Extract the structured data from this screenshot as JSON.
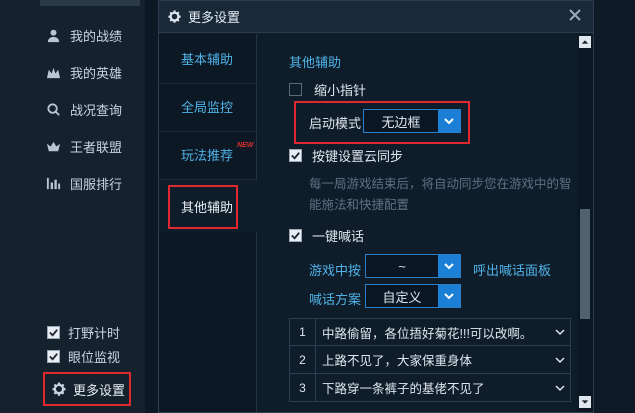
{
  "sidebar": {
    "top_item": "",
    "items": [
      {
        "label": "我的战绩",
        "icon": "user-icon"
      },
      {
        "label": "我的英雄",
        "icon": "hero-icon"
      },
      {
        "label": "战况查询",
        "icon": "search-icon"
      },
      {
        "label": "王者联盟",
        "icon": "crown-icon"
      },
      {
        "label": "国服排行",
        "icon": "bar-chart-icon"
      }
    ],
    "checks": [
      {
        "label": "打野计时",
        "checked": true
      },
      {
        "label": "眼位监视",
        "checked": true
      }
    ],
    "more_settings": "更多设置"
  },
  "dialog": {
    "title": "更多设置",
    "nav": [
      {
        "label": "基本辅助"
      },
      {
        "label": "全局监控"
      },
      {
        "label": "玩法推荐",
        "badge": "NEW"
      },
      {
        "label": "其他辅助",
        "active": true
      }
    ],
    "content": {
      "section_title": "其他辅助",
      "shrink_pointer": "缩小指针",
      "launch_mode_label": "启动模式",
      "launch_mode_value": "无边框",
      "sync_label": "按键设置云同步",
      "sync_hint": "每一局游戏结束后，将自动同步您在游戏中的智能施法和快捷配置",
      "shout_label": "一键喊话",
      "in_game_key_label": "游戏中按",
      "in_game_key_value": "~",
      "call_panel_link": "呼出喊话面板",
      "shout_scheme_label": "喊话方案",
      "shout_scheme_value": "自定义",
      "shout_rows": [
        {
          "num": "1",
          "text": "中路偷留，各位捂好菊花!!!可以改啊。"
        },
        {
          "num": "2",
          "text": "上路不见了，大家保重身体"
        },
        {
          "num": "3",
          "text": "下路穿一条裤子的基佬不见了"
        }
      ]
    }
  },
  "colors": {
    "accent": "#4fb2e6",
    "highlight": "#e0282f",
    "select_button": "#1b7fd6"
  }
}
